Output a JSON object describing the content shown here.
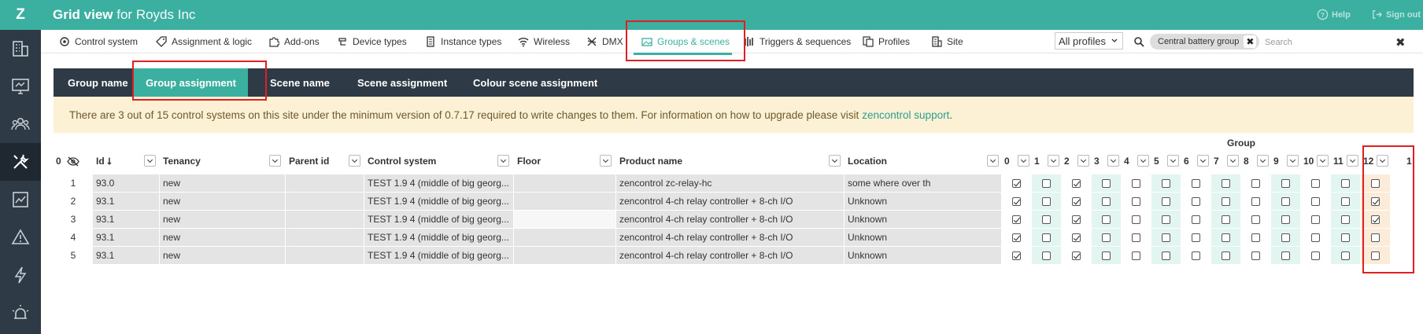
{
  "app": {
    "logo": "Z",
    "title_bold": "Grid view",
    "title_rest": " for Royds Inc",
    "help_label": "Help",
    "signout_label": "Sign out"
  },
  "sidebar": {
    "items": [
      {
        "icon": "building-icon"
      },
      {
        "icon": "monitor-icon"
      },
      {
        "icon": "users-icon"
      },
      {
        "icon": "tools-icon",
        "active": true
      },
      {
        "icon": "chart-icon"
      },
      {
        "icon": "warning-icon"
      },
      {
        "icon": "lightning-icon"
      },
      {
        "icon": "alarm-icon"
      }
    ]
  },
  "nav": {
    "tabs": [
      {
        "label": "Control system",
        "icon": "control-system-icon"
      },
      {
        "label": "Assignment & logic",
        "icon": "tag-icon"
      },
      {
        "label": "Add-ons",
        "icon": "puzzle-icon"
      },
      {
        "label": "Device types",
        "icon": "device-types-icon"
      },
      {
        "label": "Instance types",
        "icon": "instance-icon"
      },
      {
        "label": "Wireless",
        "icon": "wifi-icon"
      },
      {
        "label": "DMX",
        "icon": "dmx-icon"
      },
      {
        "label": "Groups & scenes",
        "icon": "image-icon",
        "active": true
      },
      {
        "label": "Triggers & sequences",
        "icon": "bars-icon"
      },
      {
        "label": "Profiles",
        "icon": "profiles-icon"
      },
      {
        "label": "Site",
        "icon": "site-icon"
      }
    ],
    "profile_select": "All profiles",
    "search_chip": "Central battery group",
    "search_placeholder": "Search"
  },
  "subtabs": [
    {
      "label": "Group name"
    },
    {
      "label": "Group assignment",
      "active": true
    },
    {
      "label": "Scene name"
    },
    {
      "label": "Scene assignment"
    },
    {
      "label": "Colour scene assignment"
    }
  ],
  "warning": {
    "text": "There are 3 out of 15 control systems on this site under the minimum version of 0.7.17 required to write changes to them. For information on how to upgrade please visit",
    "link": "zencontrol support",
    "suffix": "."
  },
  "grid": {
    "group_header": "Group",
    "row_count_label": "0",
    "columns": {
      "id": "Id ⭣",
      "tenancy": "Tenancy",
      "parent_id": "Parent id",
      "control_system": "Control system",
      "floor": "Floor",
      "product_name": "Product name",
      "location": "Location"
    },
    "group_columns": [
      "0",
      "1",
      "2",
      "3",
      "4",
      "5",
      "6",
      "7",
      "8",
      "9",
      "10",
      "11",
      "12",
      "1"
    ],
    "rows": [
      {
        "n": "1",
        "id": "93.0",
        "tenancy": "new",
        "parent_id": "",
        "control_system": "TEST 1.9 4 (middle of big georg...",
        "floor": "",
        "product_name": "zencontrol zc-relay-hc",
        "location": "some where over th",
        "groups": [
          1,
          0,
          1,
          0,
          0,
          0,
          0,
          0,
          0,
          0,
          0,
          0,
          0
        ]
      },
      {
        "n": "2",
        "id": "93.1",
        "tenancy": "new",
        "parent_id": "",
        "control_system": "TEST 1.9 4 (middle of big georg...",
        "floor": "",
        "product_name": "zencontrol 4-ch relay controller + 8-ch I/O",
        "location": "Unknown",
        "groups": [
          1,
          0,
          1,
          0,
          0,
          0,
          0,
          0,
          0,
          0,
          0,
          0,
          1
        ]
      },
      {
        "n": "3",
        "id": "93.1",
        "tenancy": "new",
        "parent_id": "",
        "control_system": "TEST 1.9 4 (middle of big georg...",
        "floor": "",
        "product_name": "zencontrol 4-ch relay controller + 8-ch I/O",
        "location": "Unknown",
        "groups": [
          1,
          0,
          1,
          0,
          0,
          0,
          0,
          0,
          0,
          0,
          0,
          0,
          1
        ]
      },
      {
        "n": "4",
        "id": "93.1",
        "tenancy": "new",
        "parent_id": "",
        "control_system": "TEST 1.9 4 (middle of big georg...",
        "floor": "",
        "product_name": "zencontrol 4-ch relay controller + 8-ch I/O",
        "location": "Unknown",
        "groups": [
          1,
          0,
          1,
          0,
          0,
          0,
          0,
          0,
          0,
          0,
          0,
          0,
          0
        ]
      },
      {
        "n": "5",
        "id": "93.1",
        "tenancy": "new",
        "parent_id": "",
        "control_system": "TEST 1.9 4 (middle of big georg...",
        "floor": "",
        "product_name": "zencontrol 4-ch relay controller + 8-ch I/O",
        "location": "Unknown",
        "groups": [
          1,
          0,
          1,
          0,
          0,
          0,
          0,
          0,
          0,
          0,
          0,
          0,
          0
        ]
      }
    ]
  },
  "colors": {
    "brand": "#3bb0a0",
    "sidebar": "#2e3a46",
    "warning_bg": "#fcf1d4",
    "highlight": "#e02020"
  }
}
